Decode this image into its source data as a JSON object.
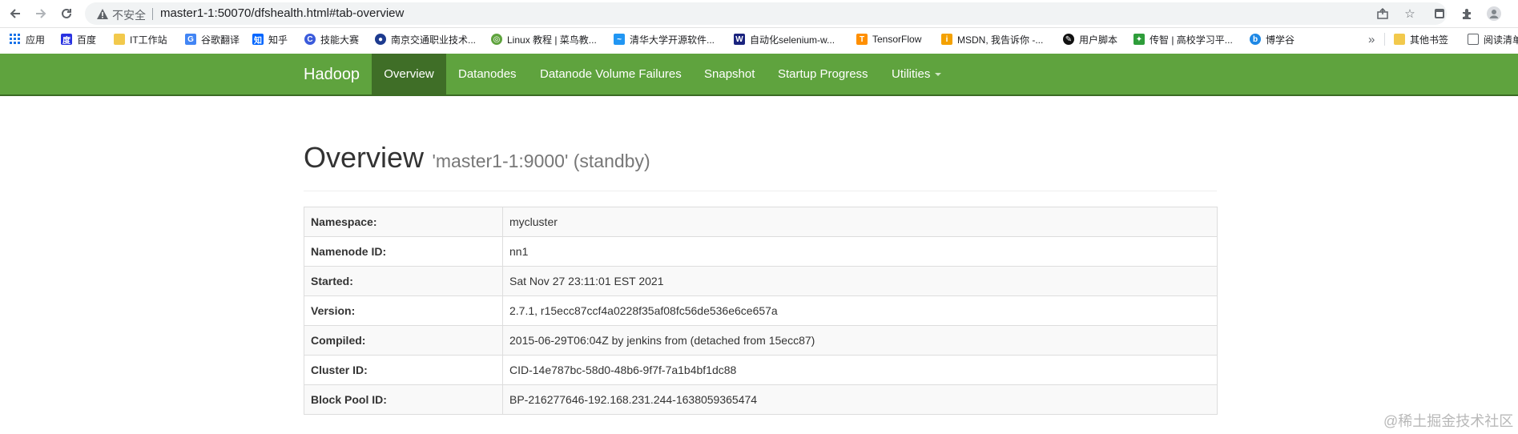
{
  "browser": {
    "security_label": "不安全",
    "url": "master1-1:50070/dfshealth.html#tab-overview",
    "bookmarks": [
      {
        "label": "应用",
        "icon": "apps-grid-icon",
        "color": "#1a73e8"
      },
      {
        "label": "百度",
        "icon": "baidu-paw-icon",
        "color": "#2932e1"
      },
      {
        "label": "IT工作站",
        "icon": "folder-icon",
        "color": "#f2c94c"
      },
      {
        "label": "谷歌翻译",
        "icon": "google-translate-icon",
        "color": "#4285f4"
      },
      {
        "label": "知乎",
        "icon": "zhihu-icon",
        "color": "#0066ff"
      },
      {
        "label": "技能大赛",
        "icon": "moon-logo-icon",
        "color": "#3b5bdb"
      },
      {
        "label": "南京交通职业技术...",
        "icon": "school-logo-icon",
        "color": "#1d3b8f"
      },
      {
        "label": "Linux 教程 | 菜鸟教...",
        "icon": "runoob-icon",
        "color": "#5fa33e"
      },
      {
        "label": "清华大学开源软件...",
        "icon": "tsinghua-icon",
        "color": "#2196f3"
      },
      {
        "label": "自动化selenium-w...",
        "icon": "w-logo-icon",
        "color": "#1a237e"
      },
      {
        "label": "TensorFlow",
        "icon": "tensorflow-icon",
        "color": "#ff8f00"
      },
      {
        "label": "MSDN, 我告诉你 -...",
        "icon": "msdn-icon",
        "color": "#f4a100"
      },
      {
        "label": "用户脚本",
        "icon": "userscript-icon",
        "color": "#111111"
      },
      {
        "label": "传智 | 高校学习平...",
        "icon": "chuanzhi-icon",
        "color": "#2e9d3a"
      },
      {
        "label": "博学谷",
        "icon": "boxuegu-icon",
        "color": "#1e88e5"
      }
    ],
    "more": "»",
    "other_bookmarks": "其他书签",
    "reading_list": "阅读清单"
  },
  "navbar": {
    "brand": "Hadoop",
    "items": [
      {
        "label": "Overview",
        "active": true
      },
      {
        "label": "Datanodes"
      },
      {
        "label": "Datanode Volume Failures"
      },
      {
        "label": "Snapshot"
      },
      {
        "label": "Startup Progress"
      },
      {
        "label": "Utilities"
      }
    ]
  },
  "page": {
    "title": "Overview",
    "subtitle": "'master1-1:9000' (standby)",
    "rows": [
      {
        "key": "Namespace:",
        "value": "mycluster"
      },
      {
        "key": "Namenode ID:",
        "value": "nn1"
      },
      {
        "key": "Started:",
        "value": "Sat Nov 27 23:11:01 EST 2021"
      },
      {
        "key": "Version:",
        "value": "2.7.1, r15ecc87ccf4a0228f35af08fc56de536e6ce657a"
      },
      {
        "key": "Compiled:",
        "value": "2015-06-29T06:04Z by jenkins from (detached from 15ecc87)"
      },
      {
        "key": "Cluster ID:",
        "value": "CID-14e787bc-58d0-48b6-9f7f-7a1b4bf1dc88"
      },
      {
        "key": "Block Pool ID:",
        "value": "BP-216277646-192.168.231.244-1638059365474"
      }
    ]
  },
  "watermark": "@稀土掘金技术社区",
  "colors": {
    "navbar_bg": "#5fa33e",
    "navbar_active": "#3f6e27"
  }
}
